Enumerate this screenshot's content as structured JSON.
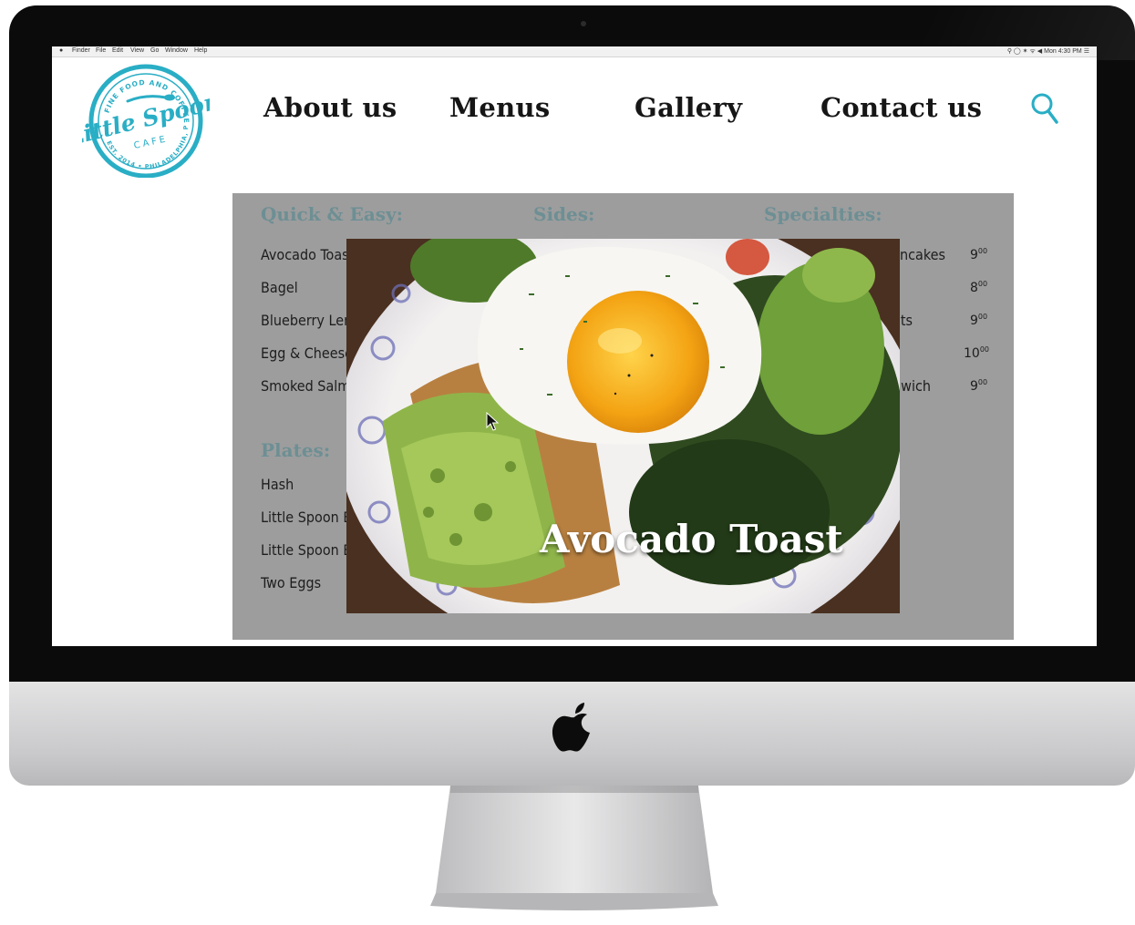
{
  "menubar": {
    "items": [
      "Finder",
      "File",
      "Edit",
      "View",
      "Go",
      "Window",
      "Help"
    ],
    "status": "⚲ ◯ ✶ ᯤ ◀ Mon 4:30 PM ☰"
  },
  "logo": {
    "name": "Little Spoon",
    "sub": "CAFE",
    "ring_top": "FINE FOOD AND COFFEE",
    "ring_bottom": "EST. 2014 • PHILADELPHIA, PA",
    "color": "#29aec5"
  },
  "nav": {
    "links": [
      "About us",
      "Menus",
      "Gallery",
      "Contact us"
    ],
    "search_icon": "search-icon",
    "accent": "#29aec5"
  },
  "menu": {
    "quick_easy": {
      "title": "Quick & Easy:",
      "items": [
        "Avocado Toast",
        "Bagel",
        "Blueberry Lemon Loaf",
        "Egg & Cheese",
        "Smoked Salmon"
      ]
    },
    "sides": {
      "title": "Sides:"
    },
    "specialties": {
      "title": "Specialties:",
      "items": [
        "Pancakes",
        "",
        "Biscuits",
        "",
        "Sandwich"
      ],
      "prices": [
        {
          "dollars": "9",
          "cents": "00"
        },
        {
          "dollars": "8",
          "cents": "00"
        },
        {
          "dollars": "9",
          "cents": "00"
        },
        {
          "dollars": "10",
          "cents": "00"
        },
        {
          "dollars": "9",
          "cents": "00"
        }
      ]
    },
    "plates": {
      "title": "Plates:",
      "items": [
        "Hash",
        "Little Spoon Breakfast",
        "Little Spoon Benedict",
        "Two Eggs"
      ]
    }
  },
  "popup": {
    "caption": "Avocado Toast"
  },
  "colors": {
    "panel": "#9d9d9d",
    "section_heading": "#6d8f94",
    "text": "#1d1d1d"
  }
}
